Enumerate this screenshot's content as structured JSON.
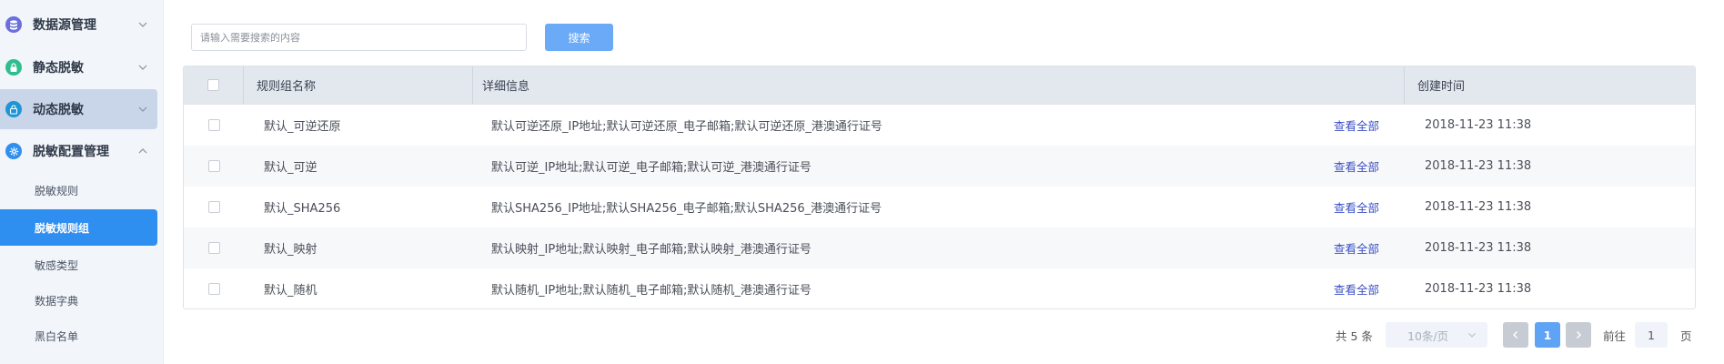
{
  "sidebar": {
    "menus": [
      {
        "label": "数据源管理",
        "icon": "database-icon",
        "color": "#6a6fdc",
        "expanded": false
      },
      {
        "label": "静态脱敏",
        "icon": "lock-icon",
        "color": "#2fbf8f",
        "expanded": false
      },
      {
        "label": "动态脱敏",
        "icon": "lock-icon",
        "color": "#1e96d6",
        "expanded": false
      },
      {
        "label": "脱敏配置管理",
        "icon": "gear-icon",
        "color": "#2f8ff0",
        "expanded": true
      }
    ],
    "sub_items": [
      {
        "label": "脱敏规则",
        "active": false
      },
      {
        "label": "脱敏规则组",
        "active": true
      },
      {
        "label": "敏感类型",
        "active": false
      },
      {
        "label": "数据字典",
        "active": false
      },
      {
        "label": "黑白名单",
        "active": false
      }
    ]
  },
  "search": {
    "placeholder": "请输入需要搜索的内容",
    "value": "",
    "button_label": "搜索"
  },
  "table": {
    "columns": [
      "规则组名称",
      "详细信息",
      "创建时间"
    ],
    "view_all_label": "查看全部",
    "rows": [
      {
        "name": "默认_可逆还原",
        "detail": "默认可逆还原_IP地址;默认可逆还原_电子邮箱;默认可逆还原_港澳通行证号",
        "created": "2018-11-23 11:38"
      },
      {
        "name": "默认_可逆",
        "detail": "默认可逆_IP地址;默认可逆_电子邮箱;默认可逆_港澳通行证号",
        "created": "2018-11-23 11:38"
      },
      {
        "name": "默认_SHA256",
        "detail": "默认SHA256_IP地址;默认SHA256_电子邮箱;默认SHA256_港澳通行证号",
        "created": "2018-11-23 11:38"
      },
      {
        "name": "默认_映射",
        "detail": "默认映射_IP地址;默认映射_电子邮箱;默认映射_港澳通行证号",
        "created": "2018-11-23 11:38"
      },
      {
        "name": "默认_随机",
        "detail": "默认随机_IP地址;默认随机_电子邮箱;默认随机_港澳通行证号",
        "created": "2018-11-23 11:38"
      }
    ]
  },
  "pagination": {
    "total": "共 5 条",
    "page_size": "10条/页",
    "current_page": "1",
    "goto_label": "前往",
    "goto_value": "1",
    "page_suffix": "页"
  },
  "colors": {
    "accent": "#2f8ff0",
    "search_button": "#6aaaf7",
    "link": "#3b4fc4"
  }
}
